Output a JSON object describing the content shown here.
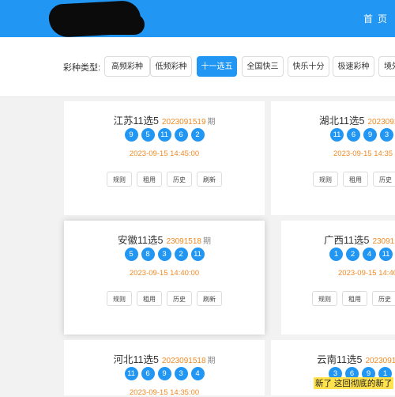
{
  "header": {
    "home_label": "首页",
    "color": "#2196f3"
  },
  "filter": {
    "label": "彩种类型:",
    "chips": [
      {
        "label": "高频彩种",
        "active": false
      },
      {
        "label": "低频彩种",
        "active": false
      },
      {
        "label": "十一选五",
        "active": true
      },
      {
        "label": "全国快三",
        "active": false
      },
      {
        "label": "快乐十分",
        "active": false
      },
      {
        "label": "极速彩种",
        "active": false
      },
      {
        "label": "境外",
        "active": false
      }
    ]
  },
  "cards": [
    {
      "name": "江苏11选5",
      "issue": "2023091519",
      "suffix": "期",
      "balls": [
        "9",
        "5",
        "11",
        "6",
        "2"
      ],
      "time": "2023-09-15 14:45:00",
      "buttons": [
        "规则",
        "租用",
        "历史",
        "刷新"
      ]
    },
    {
      "name": "湖北11选5",
      "issue": "2023091",
      "suffix": "",
      "balls": [
        "11",
        "6",
        "9",
        "3"
      ],
      "time": "2023-09-15 14:35",
      "buttons": [
        "规则",
        "租用",
        "历史"
      ]
    },
    {
      "name": "安徽11选5",
      "issue": "23091518",
      "suffix": "期",
      "balls": [
        "5",
        "8",
        "3",
        "2",
        "11"
      ],
      "time": "2023-09-15 14:40:00",
      "buttons": [
        "规则",
        "租用",
        "历史",
        "刷新"
      ]
    },
    {
      "name": "广西11选5",
      "issue": "23091",
      "suffix": "",
      "balls": [
        "1",
        "2",
        "4",
        "11"
      ],
      "time": "2023-09-15 14:40",
      "buttons": [
        "规则",
        "租用",
        "历史"
      ]
    },
    {
      "name": "河北11选5",
      "issue": "2023091518",
      "suffix": "期",
      "balls": [
        "11",
        "6",
        "9",
        "3",
        "4"
      ],
      "time": "2023-09-15 14:35:00",
      "buttons": []
    },
    {
      "name": "云南11选5",
      "issue": "2023091",
      "suffix": "",
      "balls": [
        "3",
        "6",
        "9",
        "1"
      ],
      "time": "",
      "buttons": []
    }
  ],
  "toast": "新了 这回彻底的新了",
  "colors": {
    "accent": "#2196f3",
    "issue": "#f08a24",
    "background": "#f2f2f2"
  }
}
